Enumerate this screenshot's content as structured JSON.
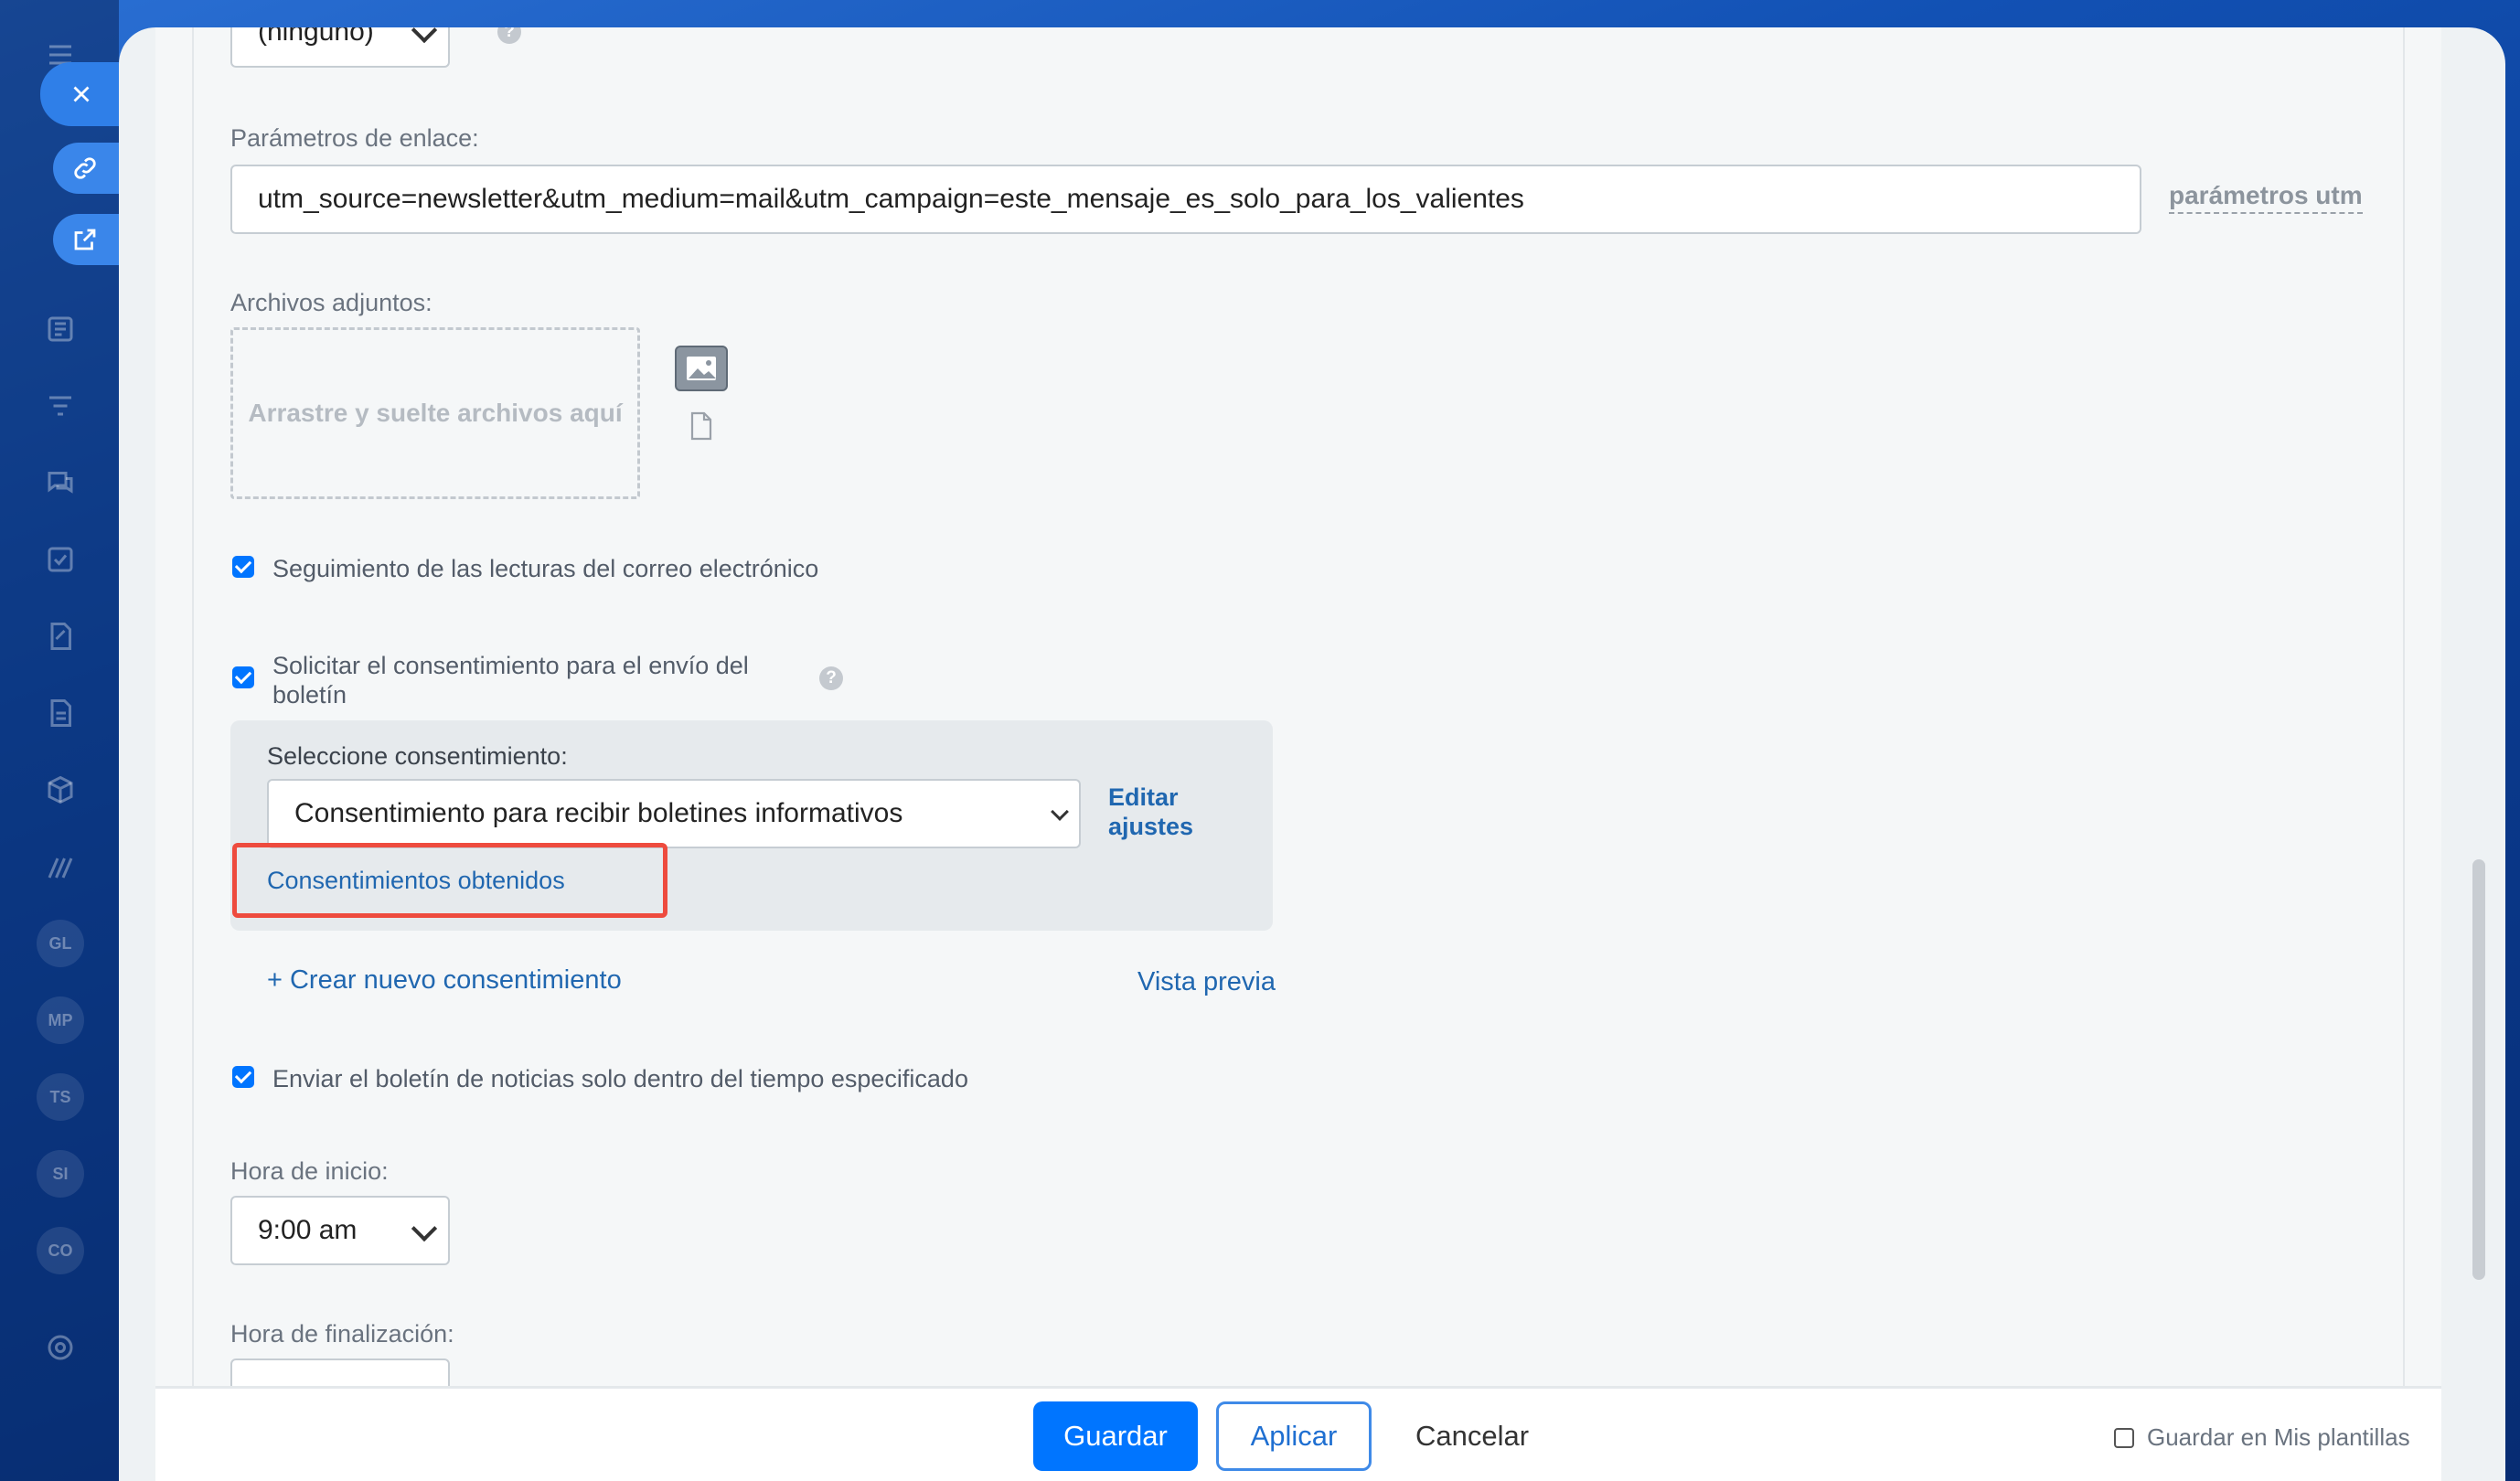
{
  "form": {
    "top_select_value": "(ninguno)",
    "link_params_label": "Parámetros de enlace:",
    "link_params_value": "utm_source=newsletter&utm_medium=mail&utm_campaign=este_mensaje_es_solo_para_los_valientes",
    "utm_link_label": "parámetros utm",
    "attachments_label": "Archivos adjuntos:",
    "dropzone_text": "Arrastre y suelte archivos aquí",
    "track_reads_label": "Seguimiento de las lecturas del correo electrónico",
    "request_consent_label": "Solicitar el consentimiento para el envío del boletín",
    "consent_select_label": "Seleccione consentimiento:",
    "consent_select_value": "Consentimiento para recibir boletines informativos",
    "edit_settings_label": "Editar ajustes",
    "obtained_consents_label": "Consentimientos obtenidos",
    "create_consent_label": "+ Crear nuevo consentimiento",
    "preview_label": "Vista previa",
    "send_within_time_label": "Enviar el boletín de noticias solo dentro del tiempo especificado",
    "start_time_label": "Hora de inicio:",
    "start_time_value": "9:00 am",
    "end_time_label": "Hora de finalización:"
  },
  "footer": {
    "save_label": "Guardar",
    "apply_label": "Aplicar",
    "cancel_label": "Cancelar",
    "save_template_label": "Guardar en Mis plantillas"
  },
  "sidebar": {
    "avatars": [
      "GL",
      "MP",
      "TS",
      "SI",
      "CO"
    ]
  },
  "colors": {
    "accent": "#0075ff",
    "link": "#2067b0",
    "highlight": "#ee4b3e"
  }
}
